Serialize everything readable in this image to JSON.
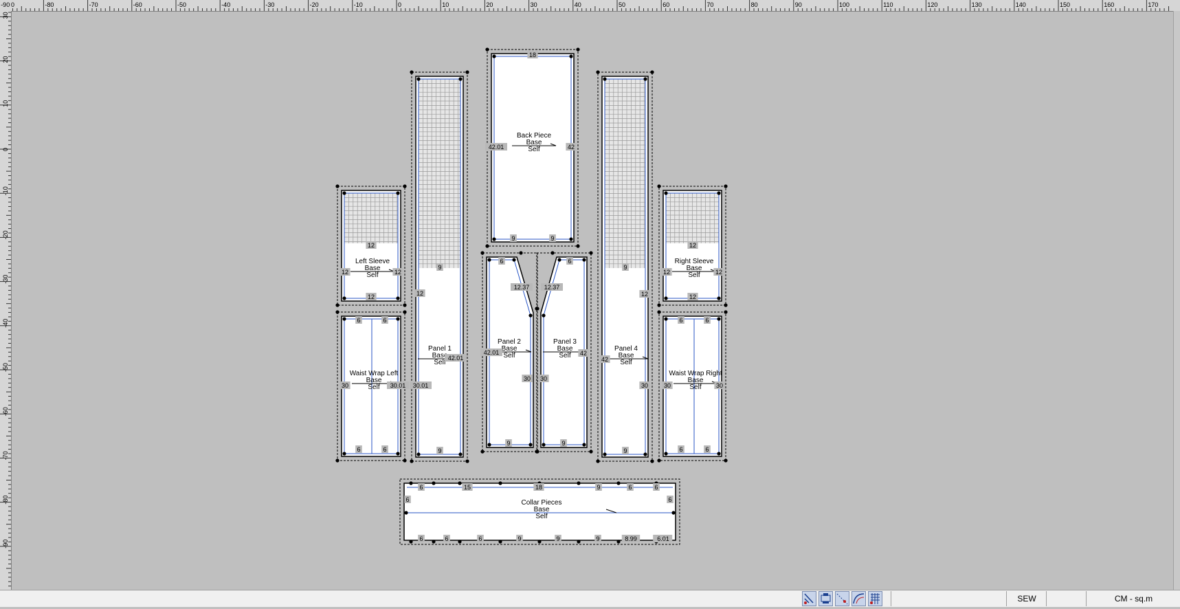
{
  "colors": {
    "canvas": "#bfbfbf",
    "piece_fill": "#ffffff",
    "seam_line": "#2a56c6",
    "grid_fill": "#e8e8e8",
    "ruler": "#d6d6d6"
  },
  "rulers": {
    "horizontal": [
      "-90",
      "-80",
      "-70",
      "-60",
      "-50",
      "-40",
      "-30",
      "-20",
      "-10",
      "0",
      "10",
      "20",
      "30",
      "40",
      "50",
      "60",
      "70",
      "80",
      "90",
      "100",
      "110",
      "120",
      "130",
      "140",
      "150",
      "160",
      "170"
    ],
    "vertical": [
      "30",
      "20",
      "10",
      "0",
      "-10",
      "-20",
      "-30",
      "-40",
      "-50",
      "-60",
      "-70",
      "-80",
      "-90",
      "-100"
    ],
    "origin": "0"
  },
  "pieces": [
    {
      "name": "Back Piece",
      "type": "Base",
      "fabric": "Self",
      "measures": [
        "18",
        "42.01",
        "42",
        "9",
        "9"
      ]
    },
    {
      "name": "Left Sleeve",
      "type": "Base",
      "fabric": "Self",
      "measures": [
        "12",
        "12",
        "12",
        "12"
      ]
    },
    {
      "name": "Right Sleeve",
      "type": "Base",
      "fabric": "Self",
      "measures": [
        "12",
        "12",
        "12",
        "12"
      ]
    },
    {
      "name": "Panel 1",
      "type": "Base",
      "fabric": "Self",
      "measures": [
        "9",
        "12",
        "42.01",
        "30.01",
        "9"
      ]
    },
    {
      "name": "Panel 2",
      "type": "Base",
      "fabric": "Self",
      "measures": [
        "6",
        "12.37",
        "42.01",
        "30",
        "9"
      ]
    },
    {
      "name": "Panel 3",
      "type": "Base",
      "fabric": "Self",
      "measures": [
        "6",
        "12.37",
        "42",
        "30",
        "9"
      ]
    },
    {
      "name": "Panel 4",
      "type": "Base",
      "fabric": "Self",
      "measures": [
        "9",
        "12",
        "42",
        "30",
        "9"
      ]
    },
    {
      "name": "Waist Wrap Left",
      "type": "Base",
      "fabric": "Self",
      "measures": [
        "6",
        "6",
        "30",
        "30.01",
        "6",
        "6"
      ]
    },
    {
      "name": "Waist Wrap Right",
      "type": "Base",
      "fabric": "Self",
      "measures": [
        "6",
        "6",
        "30",
        "30",
        "6",
        "6"
      ]
    },
    {
      "name": "Collar Pieces",
      "type": "Base",
      "fabric": "Self",
      "top_measures": [
        "6",
        "15",
        "18",
        "9",
        "6",
        "6"
      ],
      "side_measures": [
        "6",
        "6"
      ],
      "bottom_measures": [
        "6",
        "6",
        "6",
        "9",
        "9",
        "9",
        "8.99",
        "6",
        "6.01"
      ]
    }
  ],
  "statusbar": {
    "icons": [
      "cut-layout-icon",
      "plotter-icon",
      "dotted-line-icon",
      "curve-tool-icon",
      "grid-piece-icon"
    ],
    "mode": "SEW",
    "units": "CM - sq.m"
  }
}
